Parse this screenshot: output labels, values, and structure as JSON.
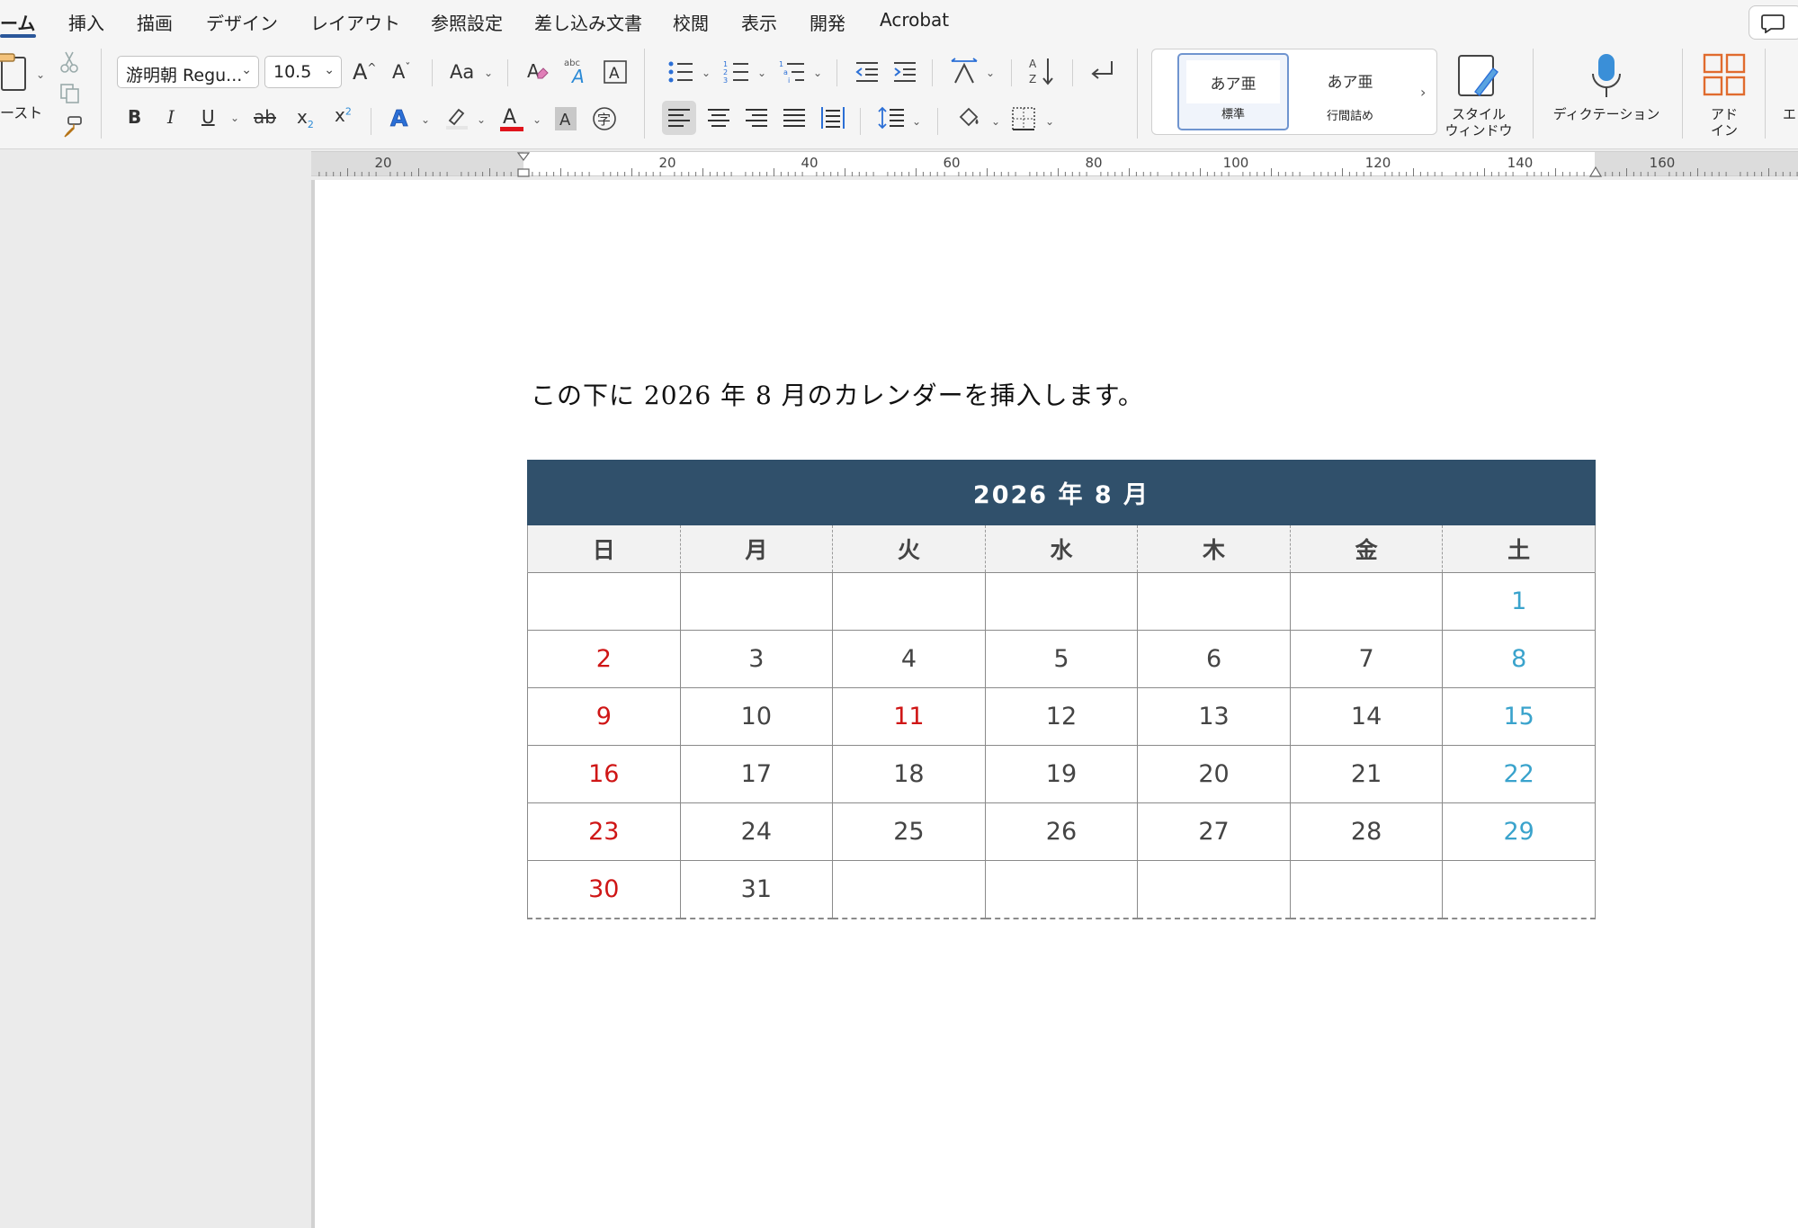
{
  "tabs": [
    {
      "label": "ーム",
      "active": true
    },
    {
      "label": "挿入"
    },
    {
      "label": "描画"
    },
    {
      "label": "デザイン"
    },
    {
      "label": "レイアウト"
    },
    {
      "label": "参照設定"
    },
    {
      "label": "差し込み文書"
    },
    {
      "label": "校閲"
    },
    {
      "label": "表示"
    },
    {
      "label": "開発"
    },
    {
      "label": "Acrobat"
    }
  ],
  "ribbon": {
    "paste_label": "ースト",
    "font_name": "游明朝 Regu...",
    "font_size": "10.5",
    "change_case": "Aa",
    "bold": "B",
    "italic": "I",
    "underline": "U",
    "strike": "ab",
    "subscript": "x",
    "superscript": "x",
    "styles": [
      {
        "preview": "あア亜",
        "name": "標準",
        "selected": true
      },
      {
        "preview": "あア亜",
        "name": "行間詰め"
      }
    ],
    "style_window_label_1": "スタイル",
    "style_window_label_2": "ウィンドウ",
    "dictation_label": "ディクテーション",
    "addin_label_1": "アド",
    "addin_label_2": "イン",
    "cut_off_label": "エ",
    "accent_color": "#2b579a"
  },
  "ruler": {
    "labels": [
      "20",
      "20",
      "40",
      "60",
      "80",
      "100",
      "120",
      "140",
      "160"
    ]
  },
  "document": {
    "intro_text": "この下に 2026 年 8 月のカレンダーを挿入します。",
    "calendar": {
      "title": "2026 年 8 月",
      "weekdays": [
        "日",
        "月",
        "火",
        "水",
        "木",
        "金",
        "土"
      ],
      "weeks": [
        [
          "",
          "",
          "",
          "",
          "",
          "",
          "1"
        ],
        [
          "2",
          "3",
          "4",
          "5",
          "6",
          "7",
          "8"
        ],
        [
          "9",
          "10",
          "11",
          "12",
          "13",
          "14",
          "15"
        ],
        [
          "16",
          "17",
          "18",
          "19",
          "20",
          "21",
          "22"
        ],
        [
          "23",
          "24",
          "25",
          "26",
          "27",
          "28",
          "29"
        ],
        [
          "30",
          "31",
          "",
          "",
          "",
          "",
          ""
        ]
      ],
      "holidays": [
        "11"
      ],
      "header_color": "#30506b",
      "sunday_color": "#cf1616",
      "saturday_color": "#3aa3cc"
    }
  }
}
